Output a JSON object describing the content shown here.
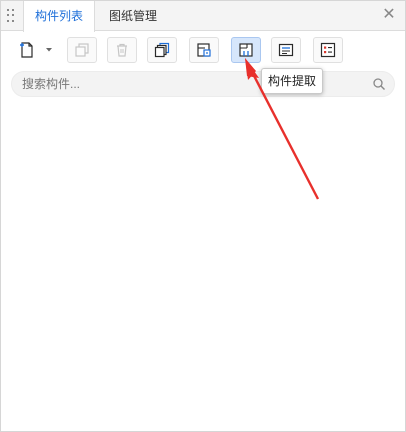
{
  "tabs": [
    {
      "label": "构件列表",
      "active": true
    },
    {
      "label": "图纸管理",
      "active": false
    }
  ],
  "close_icon": "close-icon",
  "toolbar": {
    "buttons": [
      {
        "name": "new-component-button",
        "icon": "new-file-icon",
        "enabled": true,
        "has_dropdown": true
      },
      {
        "name": "copy-button",
        "icon": "copy-icon",
        "enabled": false
      },
      {
        "name": "delete-button",
        "icon": "trash-icon",
        "enabled": false
      },
      {
        "name": "multi-copy-button",
        "icon": "stack-copy-icon",
        "enabled": true
      },
      {
        "name": "floor-copy-button",
        "icon": "layer-copy-icon",
        "enabled": true
      },
      {
        "name": "extract-component-button",
        "icon": "extract-icon",
        "enabled": true,
        "highlighted": true
      },
      {
        "name": "properties-button",
        "icon": "list-panel-icon",
        "enabled": true
      },
      {
        "name": "list-button",
        "icon": "checklist-icon",
        "enabled": true
      }
    ]
  },
  "search": {
    "placeholder": "搜索构件...",
    "value": ""
  },
  "tooltip": {
    "text": "构件提取"
  },
  "colors": {
    "accent": "#1e6fd9",
    "highlight": "#d6e6fb",
    "arrow": "#e8302c",
    "icon_red": "#d9362c"
  }
}
